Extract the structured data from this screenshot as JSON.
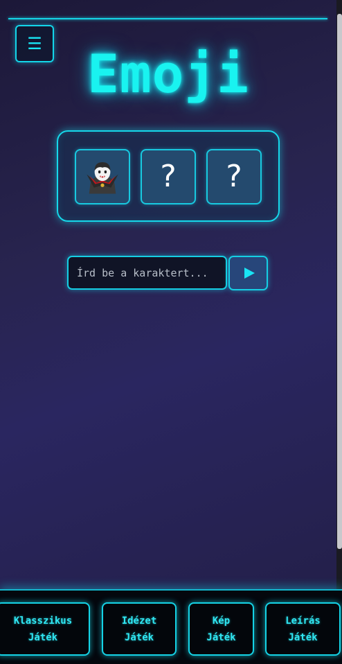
{
  "header": {
    "menu_icon": "menu-icon",
    "title": "Emoji"
  },
  "puzzle": {
    "slots": [
      {
        "type": "emoji",
        "icon": "vampire-icon"
      },
      {
        "type": "hidden",
        "text": "?"
      },
      {
        "type": "hidden",
        "text": "?"
      }
    ]
  },
  "answer": {
    "placeholder": "Írd be a karaktert...",
    "value": "",
    "submit_icon": "play-icon"
  },
  "modes": [
    {
      "line1": "Klasszikus",
      "line2": "Játék"
    },
    {
      "line1": "Idézet",
      "line2": "Játék"
    },
    {
      "line1": "Kép",
      "line2": "Játék"
    },
    {
      "line1": "Leírás",
      "line2": "Játék"
    }
  ],
  "colors": {
    "accent": "#19f3f0",
    "border": "#15d3e6",
    "background": "#28244f",
    "bottom_bar": "#04070d"
  }
}
